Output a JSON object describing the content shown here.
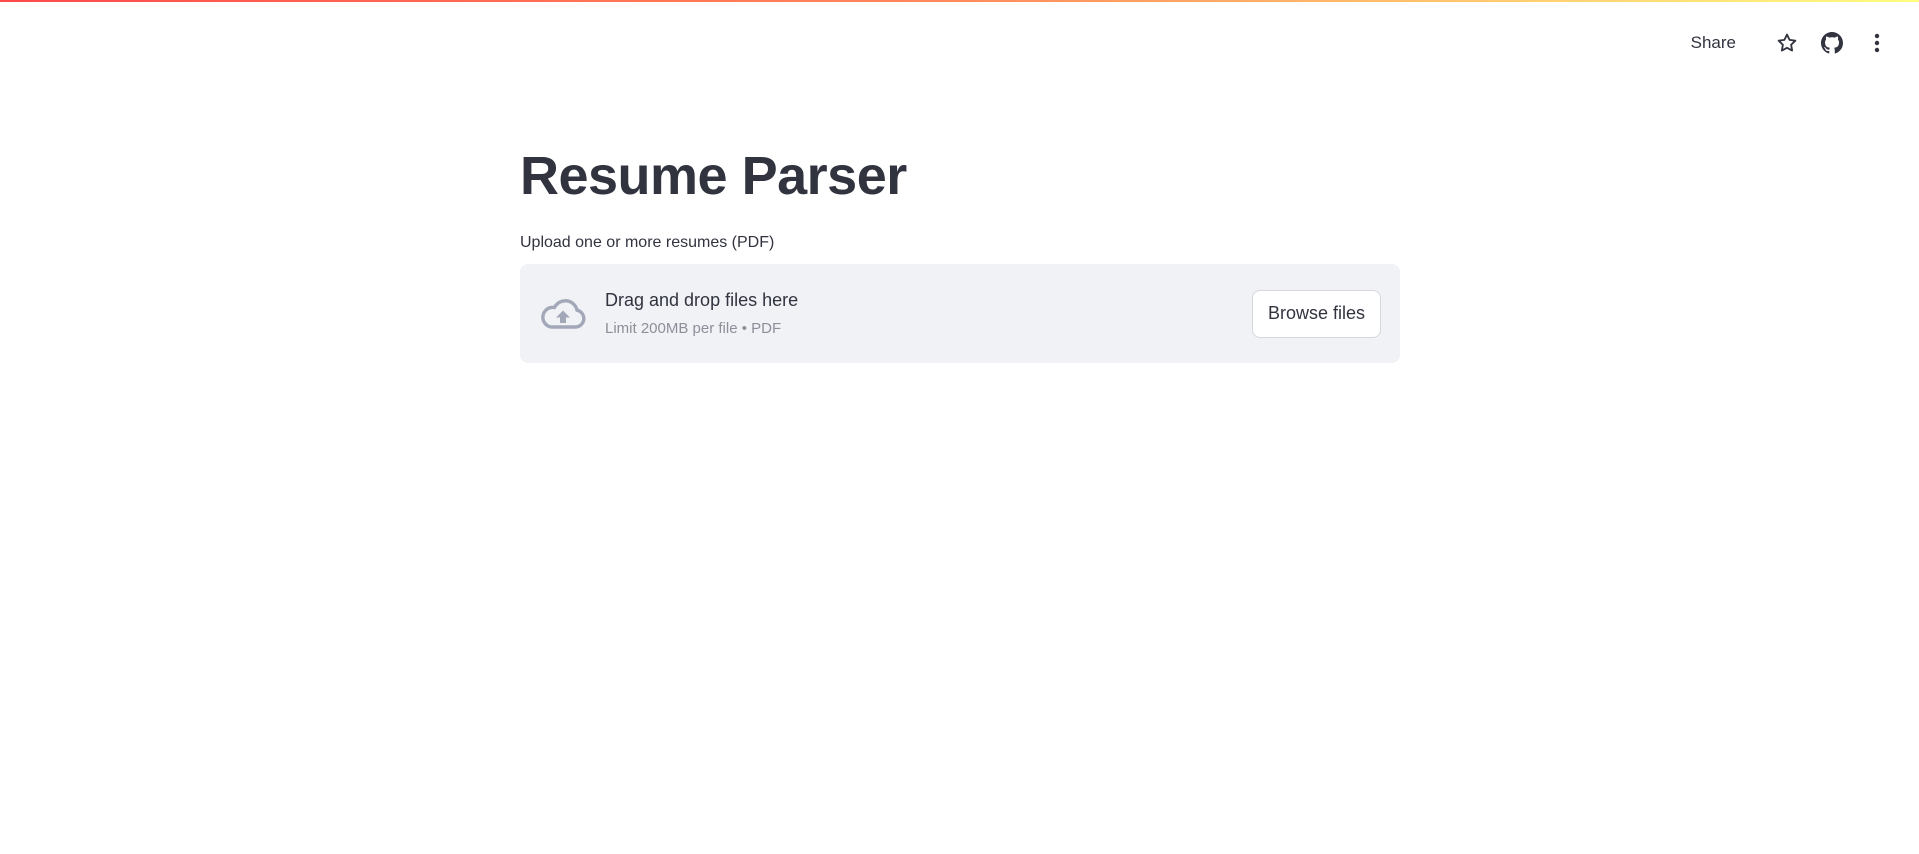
{
  "header": {
    "share_label": "Share",
    "icons": [
      "star-icon",
      "github-icon",
      "kebab-menu-icon"
    ]
  },
  "main": {
    "title": "Resume Parser",
    "uploader": {
      "label": "Upload one or more resumes (PDF)",
      "instructions": "Drag and drop files here",
      "limit": "Limit 200MB per file • PDF",
      "button_label": "Browse files",
      "icon": "cloud-upload-icon"
    }
  },
  "colors": {
    "text": "#31333f",
    "dropzone_bg": "#f0f2f6",
    "muted": "#8d8f99",
    "icon_muted": "#a3a8b8",
    "accent_stripe": [
      "#ff4b4b",
      "#fffd80"
    ]
  }
}
